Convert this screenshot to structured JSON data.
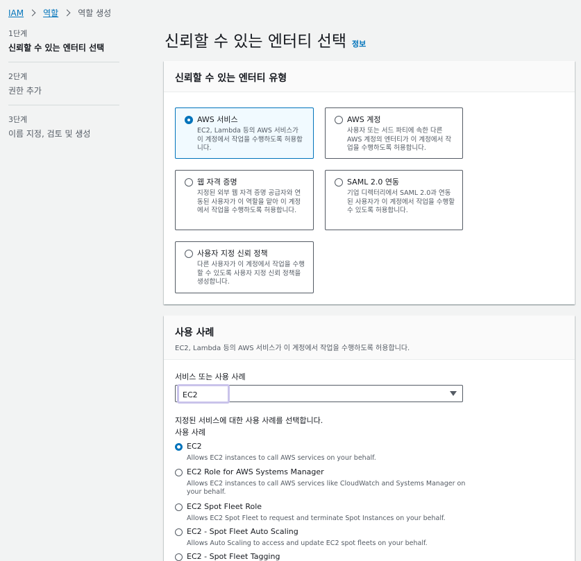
{
  "breadcrumb": {
    "iam": "IAM",
    "roles": "역할",
    "current": "역할 생성"
  },
  "steps": [
    {
      "num": "1단계",
      "title": "신뢰할 수 있는 엔터티 선택"
    },
    {
      "num": "2단계",
      "title": "권한 추가"
    },
    {
      "num": "3단계",
      "title": "이름 지정, 검토 및 생성"
    }
  ],
  "page": {
    "title": "신뢰할 수 있는 엔터티 선택",
    "info": "정보"
  },
  "entity_panel": {
    "heading": "신뢰할 수 있는 엔터티 유형",
    "tiles": [
      {
        "title": "AWS 서비스",
        "desc": "EC2, Lambda 등의 AWS 서비스가 이 계정에서 작업을 수행하도록 허용합니다."
      },
      {
        "title": "AWS 계정",
        "desc": "사용자 또는 서드 파티에 속한 다른 AWS 계정의 엔터티가 이 계정에서 작업을 수행하도록 허용합니다."
      },
      {
        "title": "웹 자격 증명",
        "desc": "지정된 외부 웹 자격 증명 공급자와 연동된 사용자가 이 역할을 맡아 이 계정에서 작업을 수행하도록 허용합니다."
      },
      {
        "title": "SAML 2.0 연동",
        "desc": "기업 디렉터리에서 SAML 2.0과 연동된 사용자가 이 계정에서 작업을 수행할 수 있도록 허용합니다."
      },
      {
        "title": "사용자 지정 신뢰 정책",
        "desc": "다른 사용자가 이 계정에서 작업을 수행할 수 있도록 사용자 지정 신뢰 정책을 생성합니다."
      }
    ]
  },
  "usecase_panel": {
    "heading": "사용 사례",
    "desc": "EC2, Lambda 등의 AWS 서비스가 이 계정에서 작업을 수행하도록 허용합니다.",
    "field_label": "서비스 또는 사용 사례",
    "selected_service": "EC2",
    "help_text": "지정된 서비스에 대한 사용 사례를 선택합니다.",
    "usecase_label": "사용 사례",
    "options": [
      {
        "title": "EC2",
        "desc": "Allows EC2 instances to call AWS services on your behalf."
      },
      {
        "title": "EC2 Role for AWS Systems Manager",
        "desc": "Allows EC2 instances to call AWS services like CloudWatch and Systems Manager on your behalf."
      },
      {
        "title": "EC2 Spot Fleet Role",
        "desc": "Allows EC2 Spot Fleet to request and terminate Spot Instances on your behalf."
      },
      {
        "title": "EC2 - Spot Fleet Auto Scaling",
        "desc": "Allows Auto Scaling to access and update EC2 spot fleets on your behalf."
      },
      {
        "title": "EC2 - Spot Fleet Tagging",
        "desc": ""
      }
    ]
  }
}
